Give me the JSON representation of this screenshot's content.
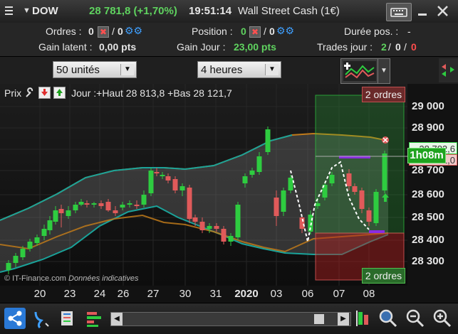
{
  "header": {
    "symbol": "DOW",
    "price_change": "28 781,8 (+1,70%)",
    "time": "19:51:14",
    "instrument": "Wall Street Cash (1€)",
    "menu_icon": "hamburger-icon",
    "keyboard_icon": "keyboard-icon",
    "minimize_icon": "minimize-icon",
    "close_icon": "close-icon"
  },
  "orders_panel": {
    "orders_label": "Ordres :",
    "orders_value": "0",
    "orders_value2": "0",
    "position_label": "Position :",
    "position_value": "0",
    "position_value2": "0",
    "duration_label": "Durée pos. :",
    "duration_value": "-",
    "latent_label": "Gain latent :",
    "latent_value": "0,00 pts",
    "day_gain_label": "Gain Jour :",
    "day_gain_value": "23,00 pts",
    "trades_label": "Trades jour :",
    "trades_win": "2",
    "trades_flat": "0",
    "trades_loss": "0",
    "slash": "/"
  },
  "selectors": {
    "units": "50 unités",
    "period": "4 heures"
  },
  "chart": {
    "legend_prefix": "Prix",
    "legend_info": "Jour :+Haut 28 813,8 +Bas 28 121,7",
    "orders_top": "2 ordres",
    "orders_bottom": "2 ordres",
    "timer": "1h08m",
    "price_tag": "28 782,6",
    "price_tag2": "28 781,0",
    "watermark": "© IT-Finance.com",
    "watermark2": "Données indicatives",
    "colors": {
      "up": "#2ecc40",
      "down": "#e05a5a",
      "band": "#1aa39a",
      "band2": "#c07a1a"
    }
  },
  "chart_data": {
    "type": "candlestick",
    "yaxis_ticks": [
      "29 000",
      "28 900",
      "28 800",
      "28 700",
      "28 600",
      "28 500",
      "28 400",
      "28 300"
    ],
    "xaxis_ticks": [
      "20",
      "23",
      "24",
      "26",
      "27",
      "30",
      "31",
      "2020",
      "03",
      "06",
      "07",
      "08"
    ],
    "ylim": [
      28230,
      29060
    ]
  },
  "toolbar": {
    "share_icon": "share-icon",
    "link_icon": "link-icon",
    "list_icon": "list-icon",
    "bars_icon": "bars-icon",
    "scroll_left_icon": "scroll-left-icon",
    "scroll_right_icon": "scroll-right-icon",
    "cursor_icon": "cursor-icon",
    "zoom_fit_icon": "zoom-fit-icon",
    "zoom_out_icon": "zoom-out-icon",
    "zoom_in_icon": "zoom-in-icon"
  }
}
